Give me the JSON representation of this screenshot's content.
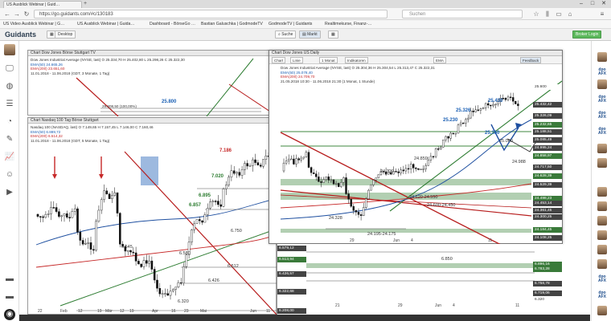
{
  "browser": {
    "tab_title": "US Ausblick Webinar | Guid…",
    "url": "https://go.guidants.com/#c/130183",
    "search_placeholder": "Suchen",
    "bookmarks": [
      "US Video Ausblick Webinar | G…",
      "US Ausblick Webinar | Guida…",
      "Dashboard - BörseGo …",
      "Bastian Galuschka | GodmodeTV",
      "GodmodeTV | Guidants",
      "Realtimekurse, Finanz-…"
    ]
  },
  "app": {
    "logo": "Guidants",
    "desktop_label": "Desktop",
    "suche_label": "Suche",
    "markt_label": "Markt",
    "broker_label": "Broker Login"
  },
  "panel_dow_top": {
    "title": "Chart Dow Jones Börse Stuttgart TV",
    "legend": [
      "Dow Jones Industrial Average (NYSE, last)  O 25.334,70  H 25.402,80  L 25.298,26  C 25.322,30",
      "EMA(50)  24.665,26",
      "EMA(200)  23.651,60",
      "11.01.2018 - 11.06.2018 (GDT, 3 Monate, 1 Tag)"
    ],
    "labels": {
      "pct": "29.808,50 (100,00%)",
      "level": "25.800"
    }
  },
  "panel_nasdaq": {
    "title": "Chart Nasdaq 100 Tag Börse Stuttgart",
    "legend": [
      "Nasdaq 100 (NASDAQ, last)  O 7.149,65  H 7.157,45  L 7.146,00  C 7.160,46",
      "EMA(50)  6.889,72",
      "EMA(200)  6.514,32",
      "11.01.2018 - 11.06.2018 (GDT, 5 Monate, 1 Tag)"
    ],
    "levels": [
      "7.186",
      "7.020",
      "6.895",
      "6.857",
      "6.750",
      "6.645",
      "6.580",
      "6.512",
      "6.426",
      "6.320"
    ],
    "xticks": [
      "22",
      "Feb",
      "12",
      "19",
      "Mär",
      "12",
      "19",
      "Apr",
      "16",
      "23",
      "Mai",
      "Jun",
      "11"
    ]
  },
  "panel_dow_main": {
    "title": "Chart Dow Jones US Daily",
    "toolbar": [
      "Chart",
      "Linie",
      "1 Monat",
      "Indikatoren",
      "EMA",
      "Feedback"
    ],
    "legend": [
      "Dow Jones Industrial Average (NYSE, last)  O 25.304,36  H 25.304,54  L 25.313,47  C 25.322,31",
      "EMA(50)  25.078,40",
      "EMA(200)  24.709,70",
      "21.05.2018 10:30 - 11.06.2018 21:30  (1 Monat, 1 Stunde)"
    ],
    "levels": {
      "top": "25.430",
      "mid": "25.326",
      "l3": "25.230",
      "l4": "25.160",
      "l5": "25.080",
      "l6": "24.988",
      "l7": "24.859",
      "l8": "24.720",
      "zone1": "24.620-24.550",
      "zone2": "24.600-24.450",
      "low": "24.328",
      "zone3": "24.195-24.175"
    },
    "price_axis": [
      "25.600",
      "25.432,42",
      "25.326,09",
      "25.232,65",
      "25.188,51",
      "25.085,49",
      "24.995,24",
      "24.858,97",
      "24.717,50",
      "24.628,39",
      "24.529,39",
      "24.498,23",
      "24.453,14",
      "24.361,45",
      "24.300,25",
      "24.184,45",
      "24.108,25"
    ],
    "xticks": [
      "29",
      "Jun",
      "4",
      "11"
    ],
    "lower_axis": [
      "6.579,12",
      "6.513,94",
      "6.426,57",
      "6.322,68",
      "6.208,00"
    ],
    "lower_right_axis": [
      "6.896,16",
      "6.783,28",
      "6.758,78",
      "6.719,06",
      "6.320"
    ],
    "lower_label": "6.850",
    "lower_xticks": [
      "21",
      "29",
      "Jun",
      "4",
      "11"
    ]
  },
  "colors": {
    "accent_green": "#5cb85c",
    "support_band": "#9fc39f",
    "trend_red": "#b71c1c",
    "trend_green": "#2e7d32",
    "ema_blue": "#1e4fa0"
  }
}
